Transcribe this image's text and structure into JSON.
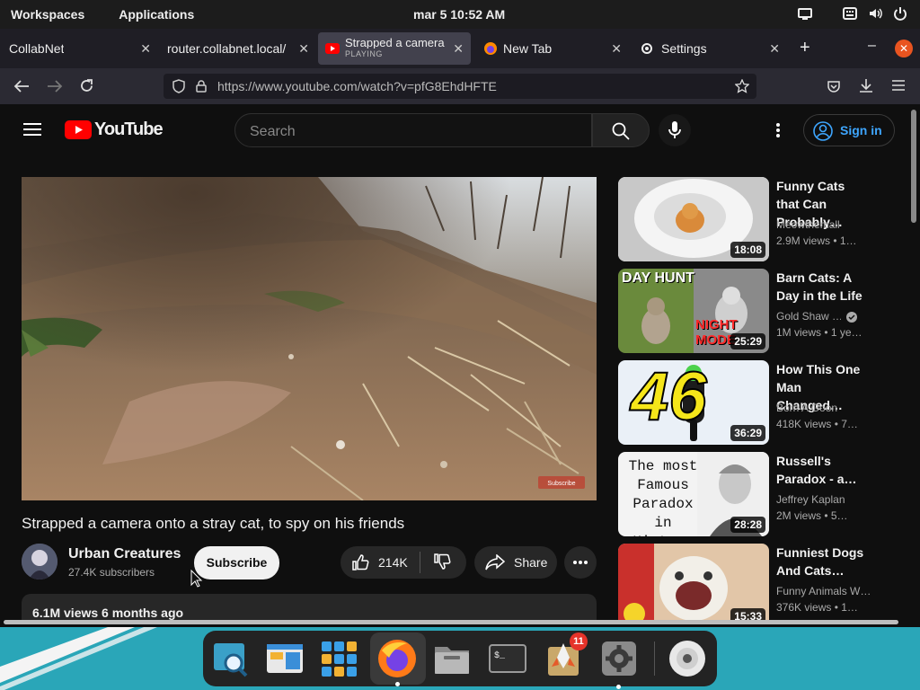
{
  "topbar": {
    "workspaces": "Workspaces",
    "applications": "Applications",
    "clock": "mar 5  10:52 AM"
  },
  "browser": {
    "tabs": [
      {
        "title": "CollabNet"
      },
      {
        "title": "router.collabnet.local/"
      },
      {
        "title": "Strapped a camera",
        "status": "PLAYING"
      },
      {
        "title": "New Tab"
      },
      {
        "title": "Settings"
      }
    ],
    "url": "https://www.youtube.com/watch?v=pfG8EhdHFTE"
  },
  "youtube": {
    "logo_text": "YouTube",
    "search_placeholder": "Search",
    "signin_label": "Sign in",
    "video": {
      "title": "Strapped a camera onto a stray cat, to spy on his friends",
      "channel": "Urban Creatures",
      "subscribers": "27.4K subscribers",
      "subscribe_label": "Subscribe",
      "likes": "214K",
      "share_label": "Share",
      "meta": "6.1M views  6 months ago",
      "watermark": "Subscribe"
    },
    "recommendations": [
      {
        "title": "Funny Cats that Can Probably…",
        "channel": "Meowthemall",
        "meta": "2.9M views  • 1…",
        "duration": "18:08"
      },
      {
        "title": "Barn Cats: A Day in the Life",
        "channel": "Gold Shaw …",
        "meta": "1M views  • 1 ye…",
        "duration": "25:29",
        "thumb_text_1": "DAY HUNT",
        "thumb_text_2": "NIGHT MODE"
      },
      {
        "title": "How This One Man Changed…",
        "channel": "Born A Goon",
        "meta": "418K views  • 7…",
        "duration": "36:29",
        "thumb_text": "46"
      },
      {
        "title": "Russell's Paradox - a…",
        "channel": "Jeffrey Kaplan",
        "meta": "2M views  • 5…",
        "duration": "28:28",
        "thumb_text": "The most Famous Paradox in History"
      },
      {
        "title": "Funniest Dogs And Cats…",
        "channel": "Funny Animals W…",
        "meta": "376K views  • 1…",
        "duration": "15:33"
      }
    ]
  },
  "dock": {
    "badge_count": "11"
  }
}
